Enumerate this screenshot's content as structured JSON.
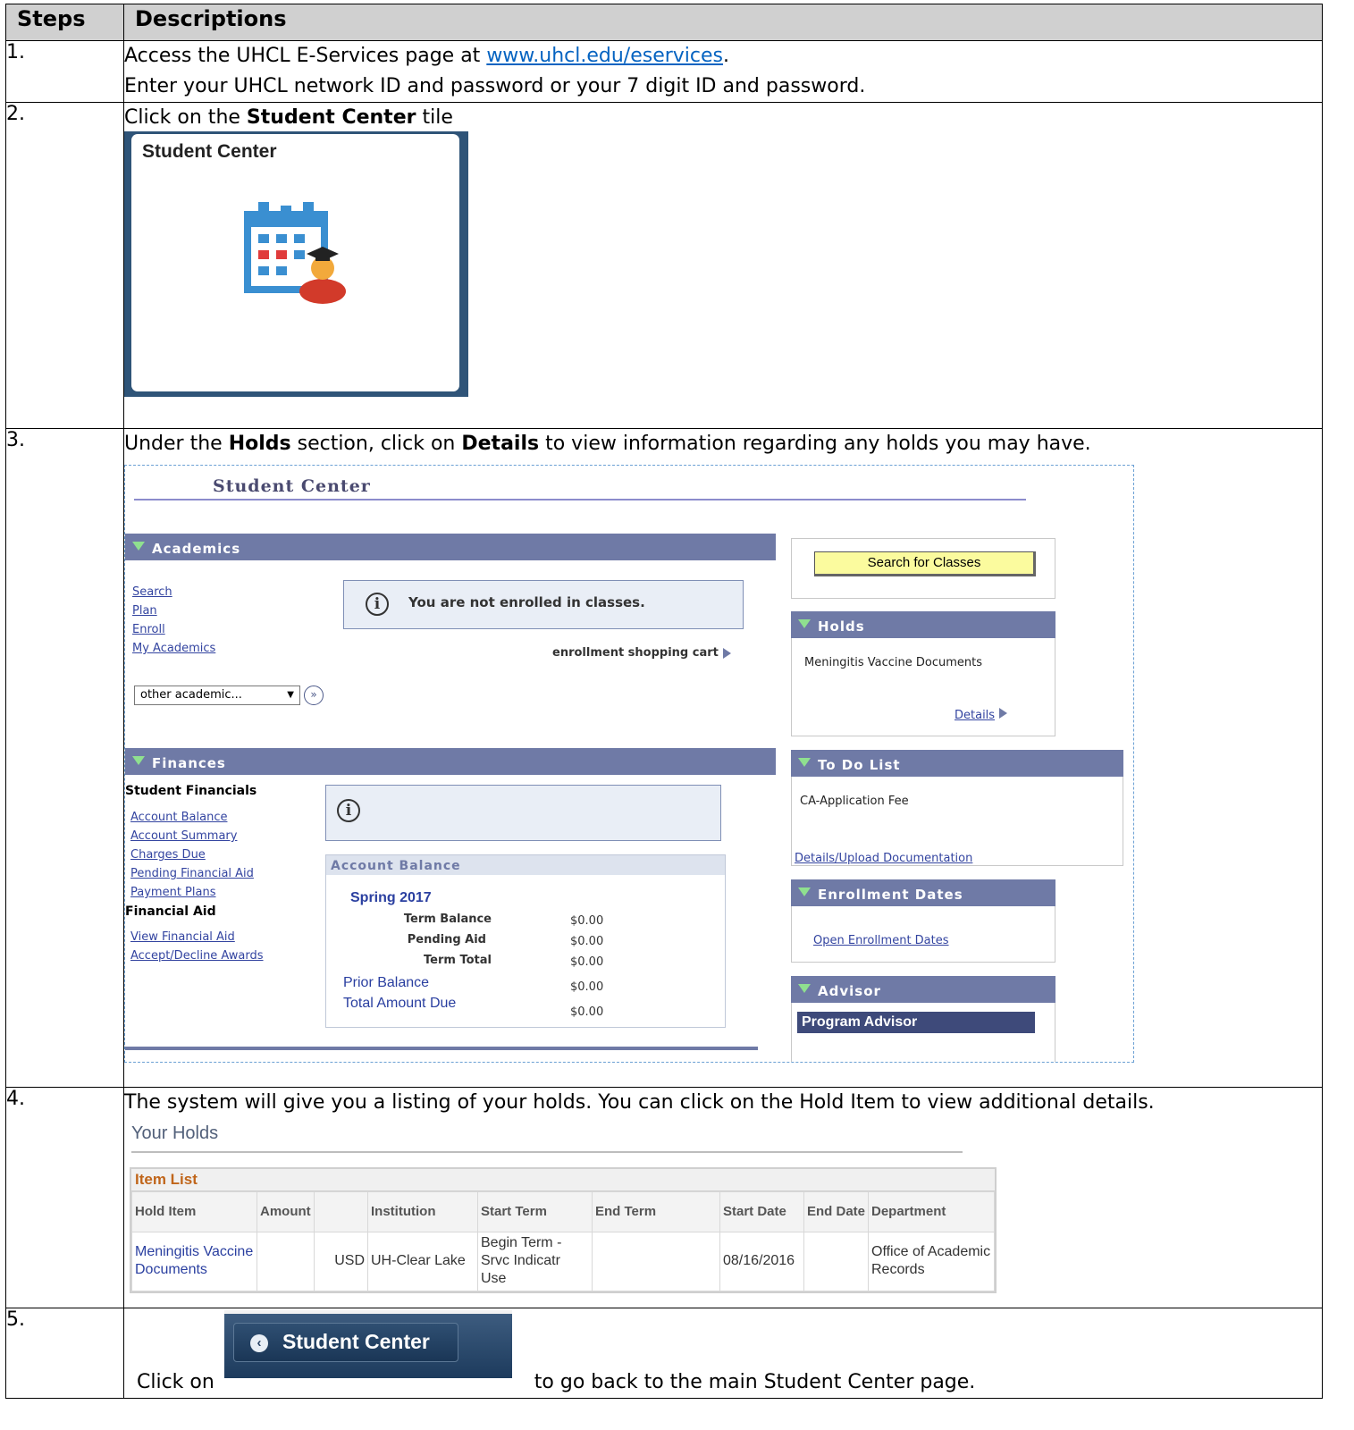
{
  "header": {
    "steps": "Steps",
    "descriptions": "Descriptions"
  },
  "step1": {
    "num": "1.",
    "line1_pre": "Access the UHCL E-Services page at ",
    "link": "www.uhcl.edu/eservices",
    "line1_post": ".",
    "line2": "Enter your UHCL network ID and password or your 7 digit ID and password."
  },
  "step2": {
    "num": "2.",
    "pre": "Click on the ",
    "bold": "Student Center",
    "post": " tile",
    "tile_title": "Student Center",
    "tile_icon": "calendar-graduate-icon"
  },
  "step3": {
    "num": "3.",
    "pre": "Under the ",
    "bold1": "Holds",
    "mid": " section, click on ",
    "bold2": "Details",
    "post": " to view information regarding any holds you may have.",
    "screen": {
      "title": "Student Center",
      "academics": {
        "header": "Academics",
        "links": [
          "Search",
          "Plan",
          "Enroll",
          "My Academics"
        ],
        "notice": "You are not enrolled in classes.",
        "cart": "enrollment shopping cart",
        "select_value": "other academic..."
      },
      "search_button": "Search for Classes",
      "holds": {
        "header": "Holds",
        "item": "Meningitis Vaccine Documents",
        "details": "Details"
      },
      "todo": {
        "header": "To Do List",
        "item": "CA-Application Fee",
        "link": "Details/Upload Documentation"
      },
      "enrollment_dates": {
        "header": "Enrollment Dates",
        "link": "Open Enrollment Dates"
      },
      "advisor": {
        "header": "Advisor",
        "program": "Program Advisor"
      },
      "finances": {
        "header": "Finances",
        "student_financials": "Student Financials",
        "sf_links": [
          "Account Balance",
          "Account Summary",
          "Charges Due",
          "Pending Financial Aid",
          "Payment Plans"
        ],
        "financial_aid": "Financial Aid",
        "fa_links": [
          "View Financial Aid",
          "Accept/Decline Awards"
        ],
        "balance_header": "Account Balance",
        "term": "Spring 2017",
        "term_balance_label": "Term Balance",
        "term_balance": "$0.00",
        "pending_aid_label": "Pending Aid",
        "pending_aid": "$0.00",
        "term_total_label": "Term Total",
        "term_total": "$0.00",
        "prior_balance_label": "Prior Balance",
        "prior_balance": "$0.00",
        "total_due_label": "Total Amount Due",
        "total_due": "$0.00"
      }
    }
  },
  "step4": {
    "num": "4.",
    "text": "The system will give you a listing of your holds.  You can click on the Hold Item to view additional details.",
    "title": "Your Holds",
    "list_title": "Item List",
    "columns": [
      "Hold Item",
      "Amount",
      "",
      "Institution",
      "Start Term",
      "End Term",
      "Start Date",
      "End Date",
      "Department"
    ],
    "row": [
      "Meningitis Vaccine Documents",
      "",
      "USD",
      "UH-Clear Lake",
      "Begin Term - Srvc Indicatr Use",
      "",
      "08/16/2016",
      "",
      "Office of Academic Records"
    ]
  },
  "step5": {
    "num": "5.",
    "pre": "Click on ",
    "button": "Student Center",
    "post": " to go back to the main Student Center page."
  }
}
